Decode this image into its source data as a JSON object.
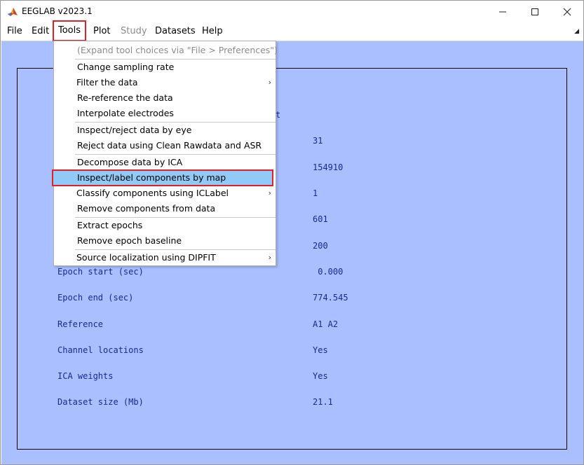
{
  "window": {
    "title": "EEGLAB v2023.1",
    "icon": "matlab-icon",
    "controls": {
      "minimize": "minimize-icon",
      "maximize": "maximize-icon",
      "close": "close-icon"
    }
  },
  "menubar": {
    "items": [
      {
        "label": "File",
        "state": "normal"
      },
      {
        "label": "Edit",
        "state": "normal"
      },
      {
        "label": "Tools",
        "state": "active"
      },
      {
        "label": "Plot",
        "state": "normal"
      },
      {
        "label": "Study",
        "state": "disabled"
      },
      {
        "label": "Datasets",
        "state": "normal"
      },
      {
        "label": "Help",
        "state": "normal"
      }
    ],
    "corner_icon": "dock-arrow-icon"
  },
  "dataset_info": {
    "hidden_partial": "t",
    "rows": [
      {
        "label": "",
        "value": "31"
      },
      {
        "label": "",
        "value": "154910"
      },
      {
        "label": "",
        "value": "1"
      },
      {
        "label": "",
        "value": "601"
      },
      {
        "label": "",
        "value": "200"
      },
      {
        "label": "Epoch start (sec)",
        "value": " 0.000"
      },
      {
        "label": "Epoch end (sec)",
        "value": "774.545"
      },
      {
        "label": "Reference",
        "value": "A1 A2"
      },
      {
        "label": "Channel locations",
        "value": "Yes"
      },
      {
        "label": "ICA weights",
        "value": "Yes"
      },
      {
        "label": "Dataset size (Mb)",
        "value": "21.1"
      }
    ]
  },
  "tools_menu": {
    "items": [
      {
        "label": "(Expand tool choices via \"File > Preferences\")",
        "disabled": true
      },
      {
        "label": "Change sampling rate"
      },
      {
        "label": "Filter the data",
        "submenu": true
      },
      {
        "label": "Re-reference the data"
      },
      {
        "label": "Interpolate electrodes"
      },
      {
        "label": "Inspect/reject data by eye"
      },
      {
        "label": "Reject data using Clean Rawdata and ASR"
      },
      {
        "label": "Decompose data by ICA"
      },
      {
        "label": "Inspect/label components by map",
        "highlighted": true
      },
      {
        "label": "Classify components using ICLabel",
        "submenu": true
      },
      {
        "label": "Remove components from data"
      },
      {
        "label": "Extract epochs"
      },
      {
        "label": "Remove epoch baseline"
      },
      {
        "label": "Source localization using DIPFIT",
        "submenu": true
      }
    ],
    "submenu_icon": "chevron-right-icon"
  },
  "colors": {
    "content_bg": "#a9bfff",
    "text_mono": "#1c2790",
    "highlight_bg": "#91c9f7",
    "annotation_red": "#e0202a"
  }
}
